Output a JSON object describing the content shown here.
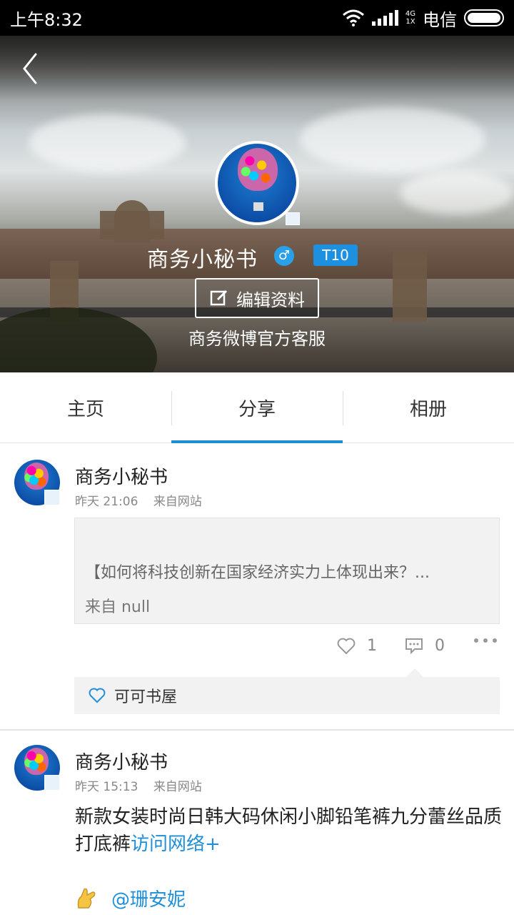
{
  "status_bar": {
    "time": "上午8:32",
    "net_top": "4G",
    "net_bottom": "1X",
    "carrier": "电信"
  },
  "profile": {
    "nickname": "商务小秘书",
    "gender_icon": "male-icon",
    "gender_glyph": "♂",
    "level": "T10",
    "edit_label": "编辑资料",
    "bio": "商务微博官方客服"
  },
  "tabs": [
    {
      "label": "主页"
    },
    {
      "label": "分享"
    },
    {
      "label": "相册"
    }
  ],
  "posts": [
    {
      "author": "商务小秘书",
      "time": "昨天 21:06",
      "source": "来自网站",
      "repost_text": "【如何将科技创新在国家经济实力上体现出来？...",
      "repost_source": "来自 null",
      "like_count": "1",
      "comment_count": "0",
      "liked_by": "可可书屋"
    },
    {
      "author": "商务小秘书",
      "time": "昨天 15:13",
      "source": "来自网站",
      "body": "新款女装时尚日韩大码休闲小脚铅笔裤九分蕾丝品质打底裤",
      "link": "访问网络+",
      "mention": "@珊安妮"
    }
  ],
  "colors": {
    "accent": "#1e90d0",
    "link": "#1e8fd8",
    "level_badge": "#1e90e0"
  }
}
